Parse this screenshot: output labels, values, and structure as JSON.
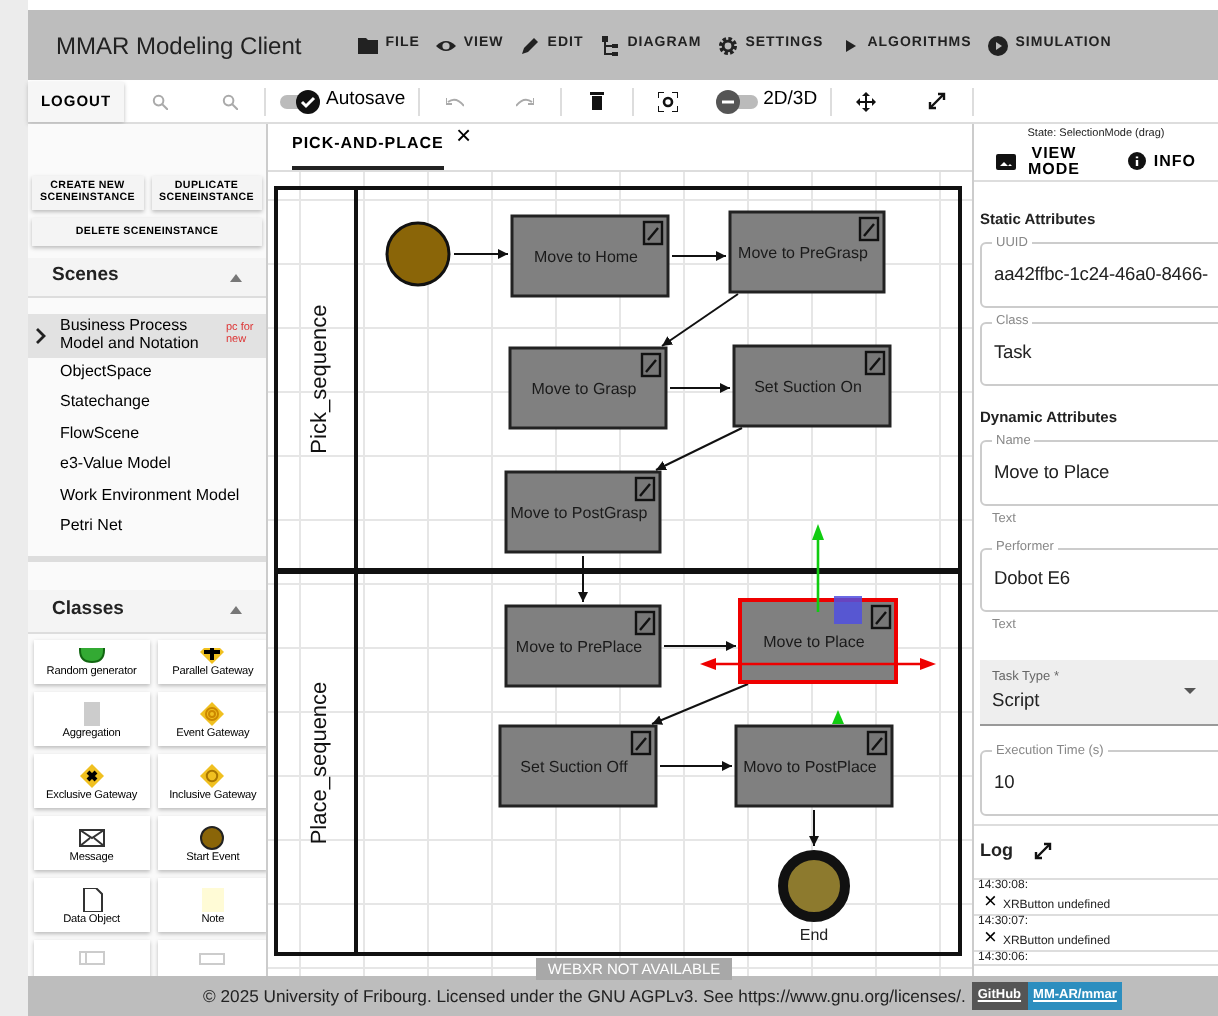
{
  "app": {
    "title": "MMAR Modeling Client"
  },
  "menu": [
    {
      "label": "FILE",
      "kind": "folder"
    },
    {
      "label": "VIEW",
      "kind": "eye"
    },
    {
      "label": "EDIT",
      "kind": "pencil"
    },
    {
      "label": "DIAGRAM",
      "kind": "diagram"
    },
    {
      "label": "SETTINGS",
      "kind": "gear"
    },
    {
      "label": "ALGORITHMS",
      "kind": "play"
    },
    {
      "label": "SIMULATION",
      "kind": "play-circle"
    }
  ],
  "toolbar": {
    "logout": "LOGOUT",
    "autosave": {
      "label": "Autosave",
      "on": true
    },
    "view_toggle": {
      "label": "2D/3D",
      "on": false
    }
  },
  "scene_buttons": [
    "CREATE NEW SCENEINSTANCE",
    "DUPLICATE SCENEINSTANCE",
    "DELETE SCENEINSTANCE"
  ],
  "scenes": {
    "title": "Scenes",
    "expanded": true,
    "items": [
      {
        "label": "Business Process Model and Notation",
        "selected": true,
        "hint": "pc for new"
      },
      {
        "label": "ObjectSpace",
        "selected": false
      },
      {
        "label": "Statechange",
        "selected": false
      },
      {
        "label": "FlowScene",
        "selected": false
      },
      {
        "label": "e3-Value Model",
        "selected": false
      },
      {
        "label": "Work Environment Model",
        "selected": false
      },
      {
        "label": "Petri Net",
        "selected": false
      }
    ]
  },
  "classes": {
    "title": "Classes",
    "expanded": true,
    "items": [
      {
        "label": "Random generator",
        "kind": "generator"
      },
      {
        "label": "Parallel Gateway",
        "kind": "parallel"
      },
      {
        "label": "Aggregation",
        "kind": "aggregation"
      },
      {
        "label": "Event Gateway",
        "kind": "event-gateway"
      },
      {
        "label": "Exclusive Gateway",
        "kind": "exclusive"
      },
      {
        "label": "Inclusive Gateway",
        "kind": "inclusive"
      },
      {
        "label": "Message",
        "kind": "message"
      },
      {
        "label": "Start Event",
        "kind": "start-event"
      },
      {
        "label": "Data Object",
        "kind": "data-object"
      },
      {
        "label": "Note",
        "kind": "note"
      },
      {
        "kind": "lane"
      },
      {
        "kind": "pool"
      }
    ]
  },
  "tabs": [
    {
      "label": "PICK-AND-PLACE",
      "selected": true,
      "close": "×"
    }
  ],
  "diagram": {
    "lanes": [
      {
        "label": "Pick_sequence"
      },
      {
        "label": "Place_sequence"
      }
    ],
    "nodes": [
      {
        "kind": "start",
        "selected": false
      },
      {
        "kind": "task",
        "label": "Move to Home",
        "selected": false
      },
      {
        "kind": "task",
        "label": "Move to PreGrasp",
        "selected": false
      },
      {
        "kind": "task",
        "label": "Move to Grasp",
        "selected": false
      },
      {
        "kind": "task",
        "label": "Set Suction On",
        "selected": false
      },
      {
        "kind": "task",
        "label": "Move to PostGrasp",
        "selected": false
      },
      {
        "kind": "task",
        "label": "Move to PrePlace",
        "selected": false
      },
      {
        "kind": "task",
        "label": "Move to Place",
        "selected": true
      },
      {
        "kind": "task",
        "label": "Set Suction Off",
        "selected": false
      },
      {
        "kind": "task",
        "label": "Movo to PostPlace",
        "selected": false
      },
      {
        "kind": "end",
        "label": "End",
        "selected": false
      }
    ],
    "webxr": "WEBXR NOT AVAILABLE"
  },
  "right_panel": {
    "state": "State: SelectionMode (drag)",
    "tabs": [
      {
        "label": "VIEW MODE",
        "kind": "image"
      },
      {
        "label": "INFO",
        "kind": "info"
      }
    ],
    "sections": [
      {
        "title": "Static Attributes",
        "fields": [
          {
            "label": "UUID",
            "value": "aa42ffbc-1c24-46a0-8466-",
            "kind": "outlined"
          },
          {
            "label": "Class",
            "value": "Task",
            "kind": "outlined"
          }
        ]
      },
      {
        "title": "Dynamic Attributes",
        "fields": [
          {
            "label": "Name",
            "value": "Move to Place",
            "helper": "Text",
            "kind": "outlined"
          },
          {
            "label": "Performer",
            "value": "Dobot E6",
            "helper": "Text",
            "kind": "outlined"
          },
          {
            "label": "Task Type *",
            "value": "Script",
            "kind": "select"
          },
          {
            "label": "Execution Time (s)",
            "value": "10",
            "kind": "outlined"
          }
        ]
      }
    ],
    "log": {
      "title": "Log",
      "entries": [
        {
          "time": "14:30:08:",
          "message": "XRButton undefined",
          "close": "×"
        },
        {
          "time": "14:30:07:",
          "message": "XRButton undefined",
          "close": "×"
        },
        {
          "time": "14:30:06:"
        }
      ]
    }
  },
  "footer": {
    "text": "© 2025 University of Fribourg. Licensed under the GNU AGPLv3. See https://www.gnu.org/licenses/.",
    "badge_label": "GitHub",
    "badge_value": "MM-AR/mmar"
  }
}
